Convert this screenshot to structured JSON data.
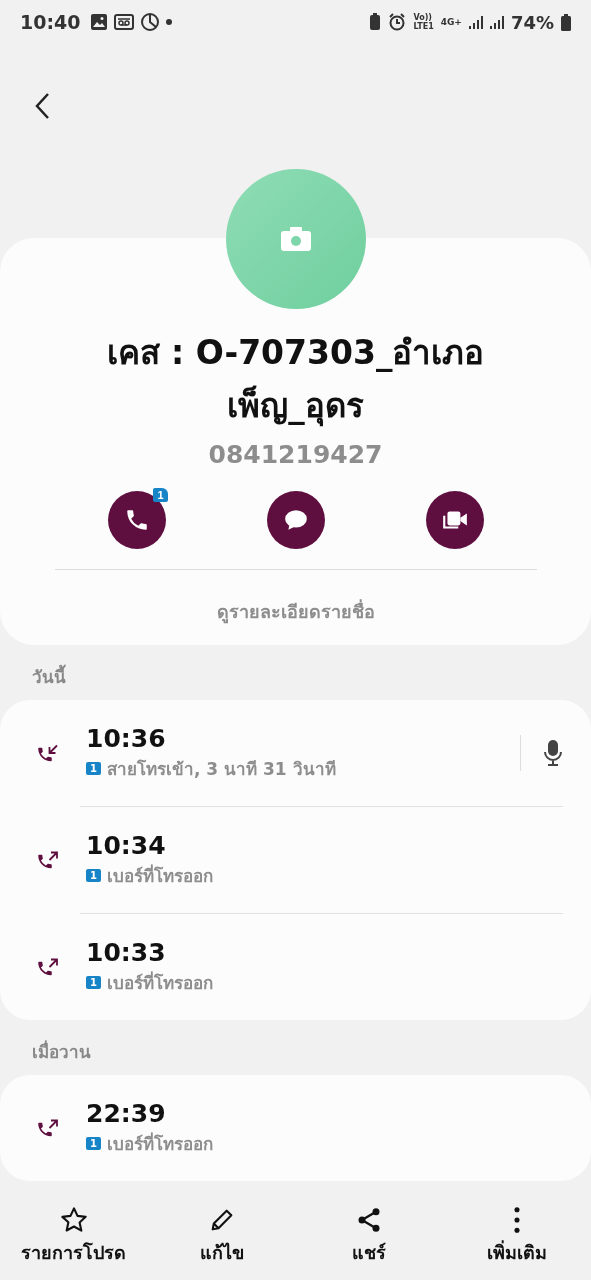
{
  "status_bar": {
    "time": "10:40",
    "volte_top": "Vo))",
    "volte_bottom": "LTE1",
    "network": "4G+",
    "battery": "74%"
  },
  "contact": {
    "name": "เคส : O-707303_อำเภอ เพ็ญ_อุดร",
    "phone": "0841219427",
    "details_link": "ดูรายละเอียดรายชื่อ",
    "actions": [
      {
        "kind": "call",
        "badge": "1"
      },
      {
        "kind": "message"
      },
      {
        "kind": "video"
      }
    ]
  },
  "call_groups": [
    {
      "heading": "วันนี้",
      "calls": [
        {
          "kind": "incoming",
          "time": "10:36",
          "sim": "1",
          "detail": "สายโทรเข้า, 3 นาที 31 วินาที",
          "recording": true
        },
        {
          "kind": "outgoing",
          "time": "10:34",
          "sim": "1",
          "detail": "เบอร์ที่โทรออก",
          "recording": false
        },
        {
          "kind": "outgoing",
          "time": "10:33",
          "sim": "1",
          "detail": "เบอร์ที่โทรออก",
          "recording": false
        }
      ]
    },
    {
      "heading": "เมื่อวาน",
      "calls": [
        {
          "kind": "outgoing",
          "time": "22:39",
          "sim": "1",
          "detail": "เบอร์ที่โทรออก",
          "recording": false
        }
      ]
    }
  ],
  "bottom_nav": [
    {
      "kind": "favorite",
      "label": "รายการโปรด"
    },
    {
      "kind": "edit",
      "label": "แก้ไข"
    },
    {
      "kind": "share",
      "label": "แชร์"
    },
    {
      "kind": "more",
      "label": "เพิ่มเติม"
    }
  ]
}
